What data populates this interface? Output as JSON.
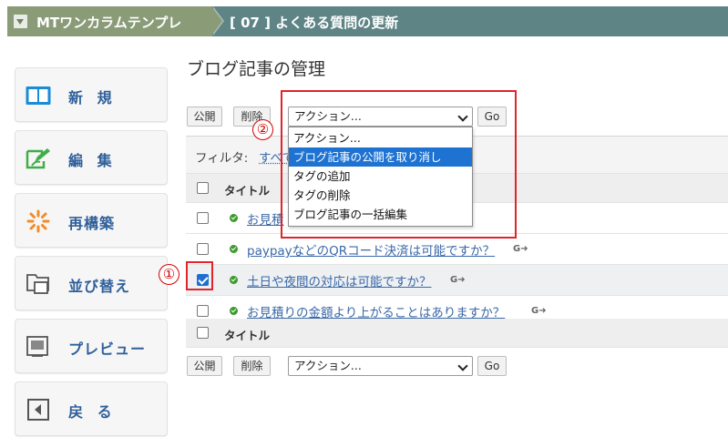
{
  "header": {
    "blog_name": "MTワンカラムテンプレ",
    "page_label": "[ 07 ] よくある質問の更新"
  },
  "sidebar": {
    "items": [
      {
        "label": "新 規",
        "icon": "book-icon"
      },
      {
        "label": "編 集",
        "icon": "edit-icon"
      },
      {
        "label": "再構築",
        "icon": "spinner-icon"
      },
      {
        "label": "並び替え",
        "icon": "sort-icon"
      },
      {
        "label": "プレビュー",
        "icon": "preview-icon"
      },
      {
        "label": "戻 る",
        "icon": "back-icon"
      }
    ]
  },
  "main": {
    "title": "ブログ記事の管理",
    "top_toolbar": {
      "publish": "公開",
      "delete": "削除",
      "action": "アクション...",
      "go": "Go"
    },
    "bottom_toolbar": {
      "publish": "公開",
      "delete": "削除",
      "action": "アクション...",
      "go": "Go"
    },
    "filter_label": "フィルタ:",
    "filter_value": "すべて",
    "column_title": "タイトル",
    "rows": [
      {
        "title": "お見積",
        "checked": false
      },
      {
        "title": "paypayなどのQRコード決済は可能ですか？",
        "checked": false
      },
      {
        "title": "土日や夜間の対応は可能ですか？",
        "checked": true
      },
      {
        "title": "お見積りの金額より上がることはありますか？",
        "checked": false
      }
    ]
  },
  "dropdown": {
    "options": [
      "アクション...",
      "ブログ記事の公開を取り消し",
      "タグの追加",
      "タグの削除",
      "ブログ記事の一括編集"
    ],
    "highlighted_index": 1
  },
  "annotations": {
    "step1": "①",
    "step2": "②"
  },
  "colors": {
    "header_blog": "#8a9b77",
    "header_page": "#5f8486",
    "link": "#3b69a8",
    "highlight": "#1e73d2",
    "annotation_red": "#e0242a"
  }
}
